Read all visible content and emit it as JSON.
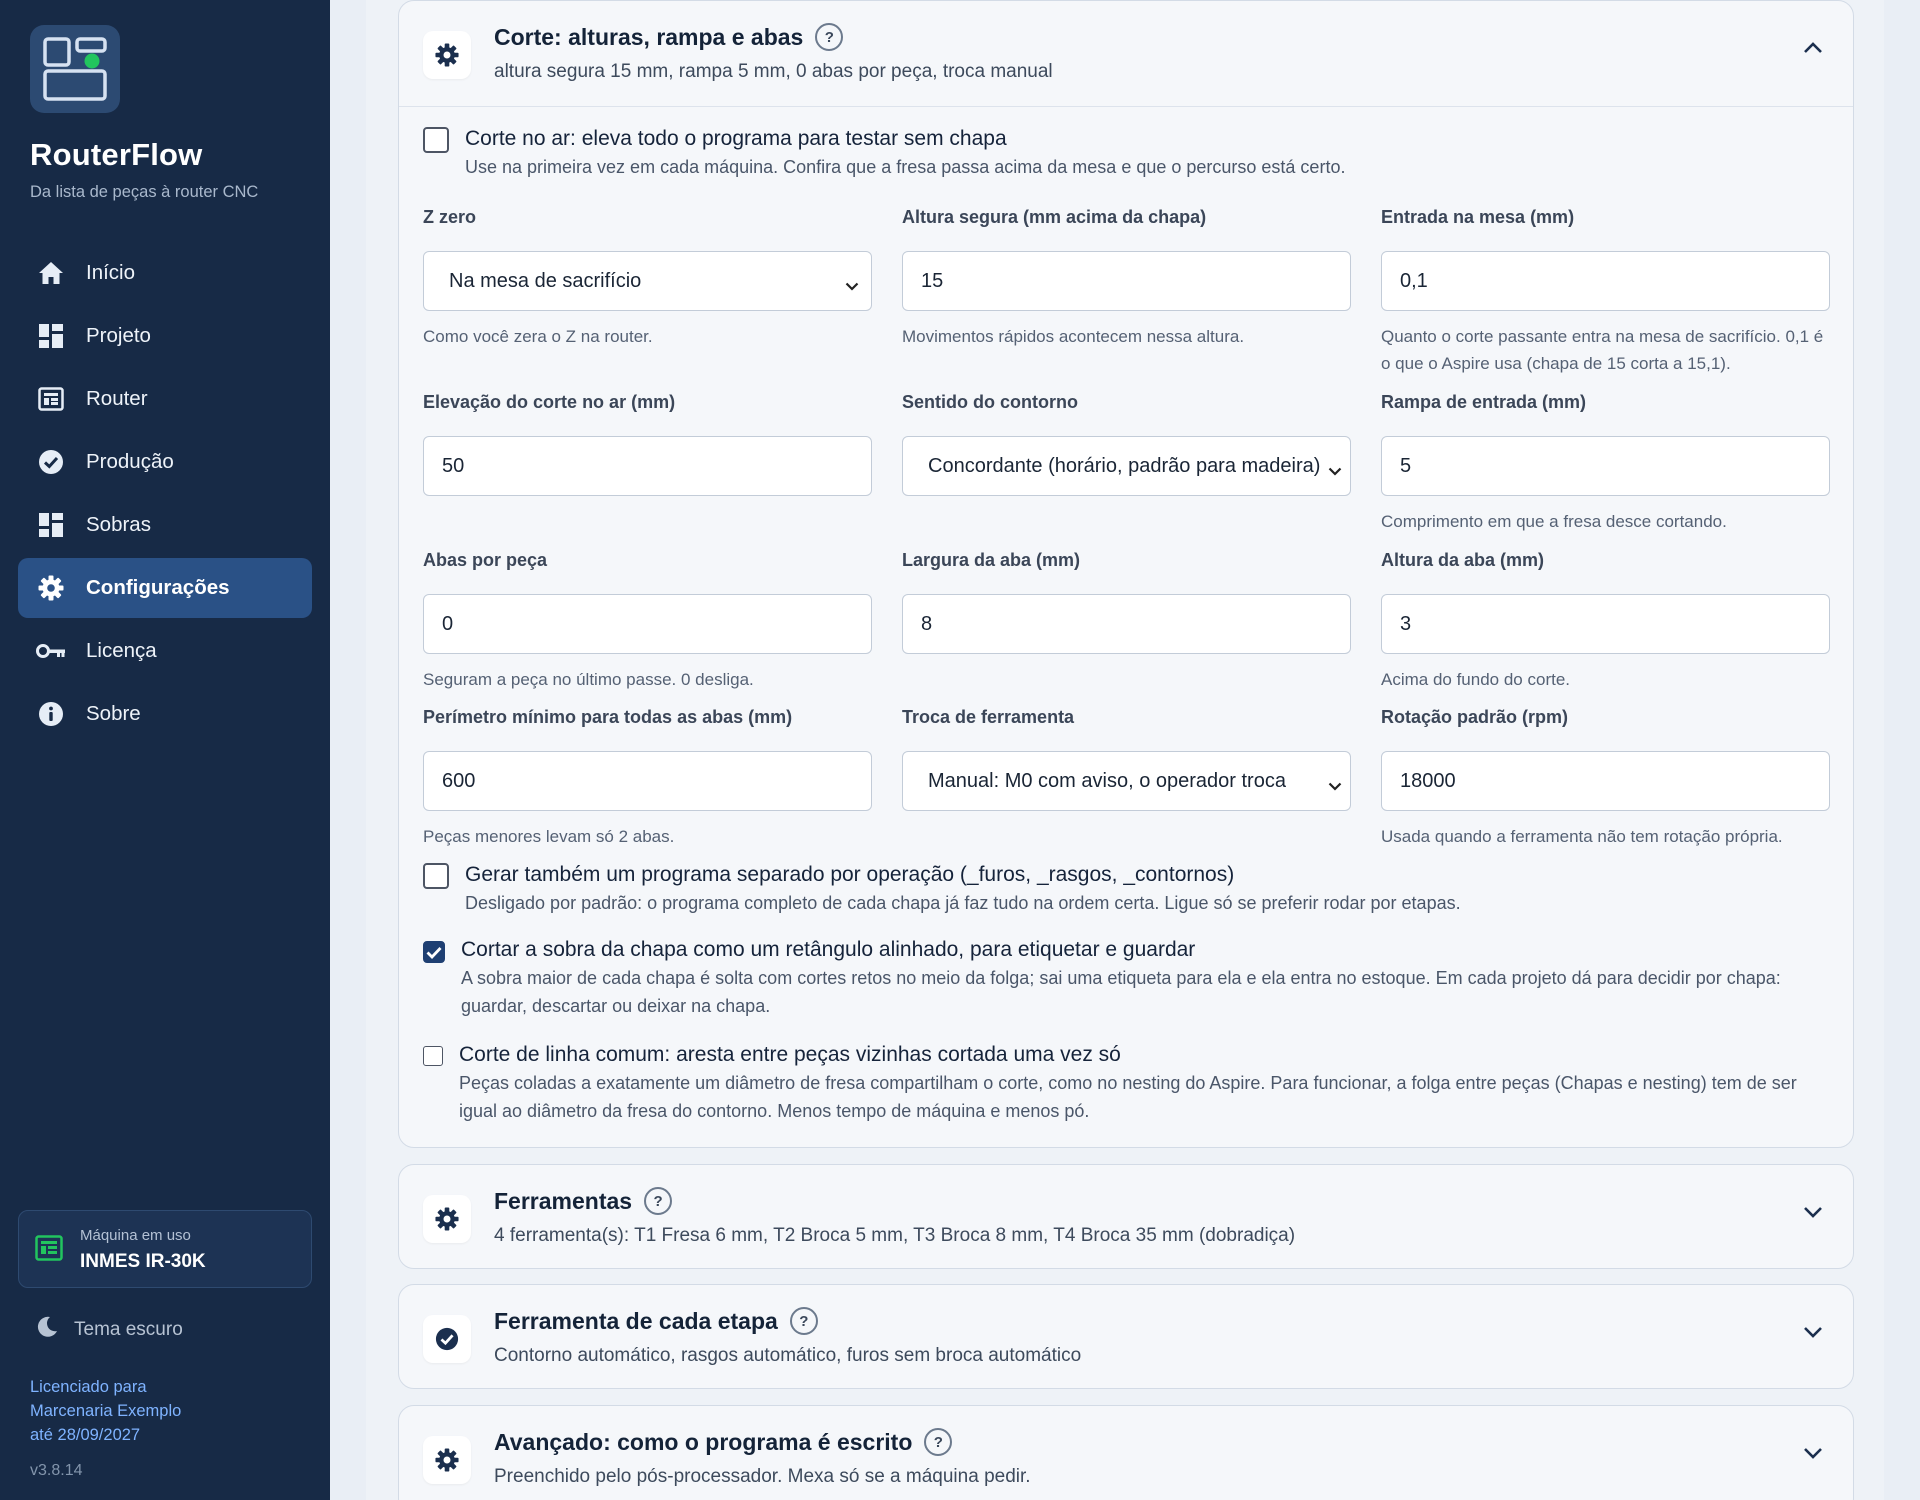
{
  "app": {
    "name": "RouterFlow",
    "tagline": "Da lista de peças à router CNC",
    "version": "v3.8.14"
  },
  "nav": {
    "items": [
      {
        "label": "Início",
        "icon": "home-icon"
      },
      {
        "label": "Projeto",
        "icon": "grid-icon"
      },
      {
        "label": "Router",
        "icon": "router-icon"
      },
      {
        "label": "Produção",
        "icon": "check-circle-icon"
      },
      {
        "label": "Sobras",
        "icon": "grid-icon"
      },
      {
        "label": "Configurações",
        "icon": "gear-icon",
        "active": true
      },
      {
        "label": "Licença",
        "icon": "key-icon"
      },
      {
        "label": "Sobre",
        "icon": "info-icon"
      }
    ]
  },
  "machine": {
    "caption": "Máquina em uso",
    "name": "INMES IR-30K"
  },
  "theme": {
    "label": "Tema escuro"
  },
  "license": {
    "line1": "Licenciado para",
    "line2": "Marcenaria Exemplo",
    "line3": "até 28/09/2027"
  },
  "cards": {
    "corte": {
      "title": "Corte: alturas, rampa e abas",
      "summary": "altura segura 15 mm, rampa 5 mm, 0 abas por peça, troca manual",
      "help": "?",
      "air_cut": {
        "title": "Corte no ar: eleva todo o programa para testar sem chapa",
        "desc": "Use na primeira vez em cada máquina. Confira que a fresa passa acima da mesa e que o percurso está certo.",
        "checked": false
      },
      "fields": {
        "z_zero": {
          "label": "Z zero",
          "value": "Na mesa de sacrifício",
          "hint": "Como você zera o Z na router."
        },
        "safe_height": {
          "label": "Altura segura (mm acima da chapa)",
          "value": "15",
          "hint": "Movimentos rápidos acontecem nessa altura."
        },
        "table_entry": {
          "label": "Entrada na mesa (mm)",
          "value": "0,1",
          "hint": "Quanto o corte passante entra na mesa de sacrifício. 0,1 é o que o Aspire usa (chapa de 15 corta a 15,1)."
        },
        "air_lift": {
          "label": "Elevação do corte no ar (mm)",
          "value": "50"
        },
        "direction": {
          "label": "Sentido do contorno",
          "value": "Concordante (horário, padrão para madeira)"
        },
        "ramp": {
          "label": "Rampa de entrada (mm)",
          "value": "5",
          "hint": "Comprimento em que a fresa desce cortando."
        },
        "tabs_per_part": {
          "label": "Abas por peça",
          "value": "0",
          "hint": "Seguram a peça no último passe. 0 desliga."
        },
        "tab_width": {
          "label": "Largura da aba (mm)",
          "value": "8"
        },
        "tab_height": {
          "label": "Altura da aba (mm)",
          "value": "3",
          "hint": "Acima do fundo do corte."
        },
        "min_perimeter": {
          "label": "Perímetro mínimo para todas as abas (mm)",
          "value": "600",
          "hint": "Peças menores levam só 2 abas."
        },
        "tool_change": {
          "label": "Troca de ferramenta",
          "value": "Manual: M0 com aviso, o operador troca"
        },
        "rpm": {
          "label": "Rotação padrão (rpm)",
          "value": "18000",
          "hint": "Usada quando a ferramenta não tem rotação própria."
        }
      },
      "separate_programs": {
        "title": "Gerar também um programa separado por operação (_furos, _rasgos, _contornos)",
        "desc": "Desligado por padrão: o programa completo de cada chapa já faz tudo na ordem certa. Ligue só se preferir rodar por etapas.",
        "checked": false
      },
      "cut_remnant": {
        "title": "Cortar a sobra da chapa como um retângulo alinhado, para etiquetar e guardar",
        "desc": "A sobra maior de cada chapa é solta com cortes retos no meio da folga; sai uma etiqueta para ela e ela entra no estoque. Em cada projeto dá para decidir por chapa: guardar, descartar ou deixar na chapa.",
        "checked": true
      },
      "common_line": {
        "title": "Corte de linha comum: aresta entre peças vizinhas cortada uma vez só",
        "desc": "Peças coladas a exatamente um diâmetro de fresa compartilham o corte, como no nesting do Aspire. Para funcionar, a folga entre peças (Chapas e nesting) tem de ser igual ao diâmetro da fresa do contorno. Menos tempo de máquina e menos pó.",
        "checked": false
      }
    },
    "ferramentas": {
      "title": "Ferramentas",
      "summary": "4 ferramenta(s): T1 Fresa 6 mm, T2 Broca 5 mm, T3 Broca 8 mm, T4 Broca 35 mm (dobradiça)",
      "help": "?"
    },
    "etapa": {
      "title": "Ferramenta de cada etapa",
      "summary": "Contorno automático, rasgos automático, furos sem broca automático",
      "help": "?"
    },
    "avancado": {
      "title": "Avançado: como o programa é escrito",
      "summary": "Preenchido pelo pós-processador. Mexa só se a máquina pedir.",
      "help": "?"
    }
  },
  "colors": {
    "sidebar": "#172a46",
    "active_nav": "#2a5186",
    "accent_green": "#22c55e",
    "license_link": "#7fb3ff",
    "checkbox_checked": "#1e3f72"
  }
}
